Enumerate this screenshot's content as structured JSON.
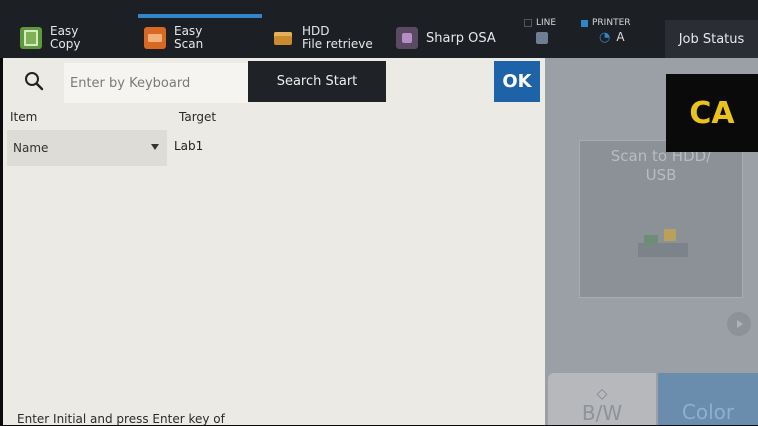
{
  "topbar": {
    "items": [
      {
        "label": "Easy\nCopy",
        "icon": "copy-icon"
      },
      {
        "label": "Easy\nScan",
        "icon": "scan-icon"
      },
      {
        "label": "HDD\nFile retrieve",
        "icon": "hdd-folder-icon"
      },
      {
        "label": "Sharp OSA",
        "icon": "osa-icon"
      }
    ],
    "line_label": "LINE",
    "printer_label": "PRINTER",
    "printer_glyph": "A",
    "job_status_label": "Job Status",
    "accent_color": "#2f86c8"
  },
  "search": {
    "placeholder": "Enter by Keyboard",
    "start_label": "Search Start",
    "ok_label": "OK"
  },
  "table": {
    "item_header": "Item",
    "target_header": "Target",
    "item_value": "Name",
    "target_value": "Lab1"
  },
  "hint": "Enter Initial and press Enter key of",
  "right_panel": {
    "card_text": "Scan to HDD/\nUSB",
    "ca_label": "CA",
    "ca_color": "#e9c21a",
    "bw_label": "B/W",
    "color_label": "Color"
  }
}
